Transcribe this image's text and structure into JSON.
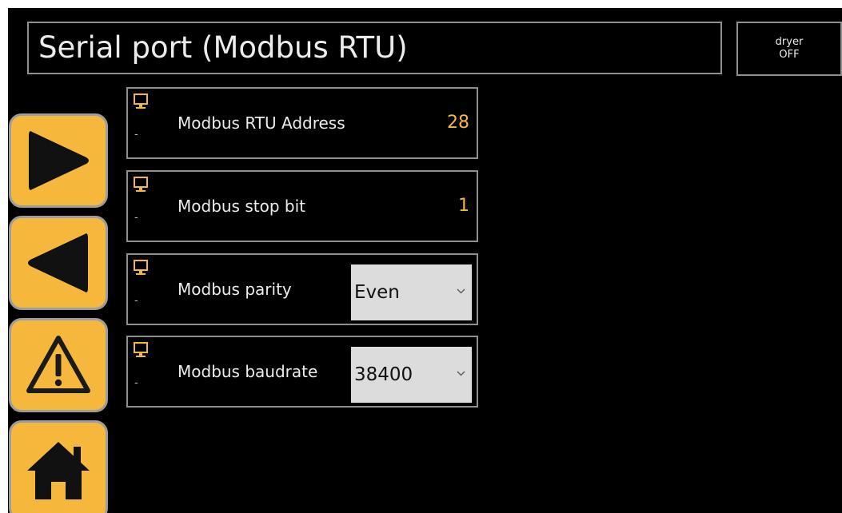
{
  "header": {
    "title": "Serial port (Modbus RTU)",
    "status_line1": "dryer",
    "status_line2": "OFF"
  },
  "nav": {
    "buttons": [
      {
        "name": "next-button",
        "icon": "play-right-icon"
      },
      {
        "name": "back-button",
        "icon": "play-left-icon"
      },
      {
        "name": "alarms-button",
        "icon": "warning-icon"
      },
      {
        "name": "home-button",
        "icon": "home-icon"
      }
    ]
  },
  "params": {
    "address": {
      "label": "Modbus RTU Address",
      "value": "28",
      "note": "-"
    },
    "stopbit": {
      "label": "Modbus stop bit",
      "value": "1",
      "note": "-"
    },
    "parity": {
      "label": "Modbus parity",
      "selected": "Even",
      "note": "-"
    },
    "baudrate": {
      "label": "Modbus baudrate",
      "selected": "38400",
      "note": "-"
    }
  },
  "colors": {
    "accent": "#f6b73d",
    "background": "#000000",
    "border": "#8f8f8f",
    "text": "#ececec",
    "select_bg": "#dcdcdc"
  },
  "icons": {
    "param_icon": "monitor-icon",
    "select_icon": "chevron-down-icon"
  }
}
